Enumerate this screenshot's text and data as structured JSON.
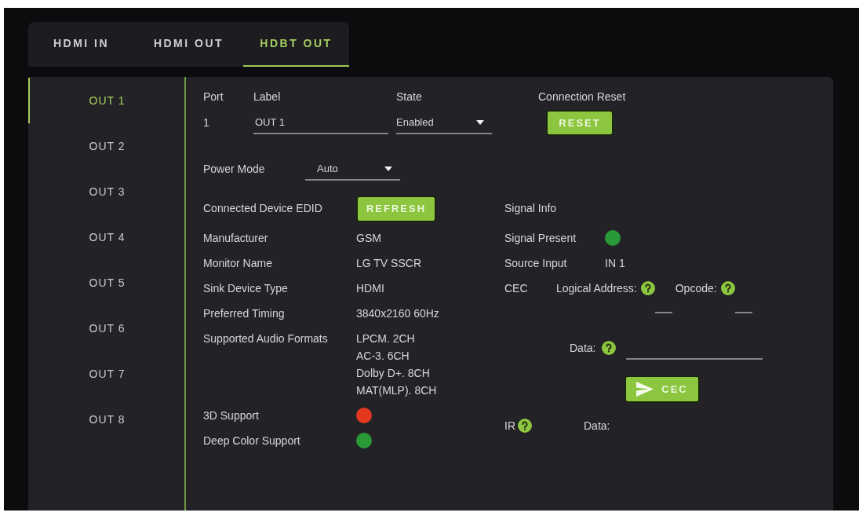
{
  "tabs": [
    {
      "label": "HDMI IN",
      "selected": false
    },
    {
      "label": "HDMI OUT",
      "selected": false
    },
    {
      "label": "HDBT OUT",
      "selected": true
    }
  ],
  "sidebar": {
    "items": [
      {
        "label": "OUT 1",
        "selected": true
      },
      {
        "label": "OUT 2",
        "selected": false
      },
      {
        "label": "OUT 3",
        "selected": false
      },
      {
        "label": "OUT 4",
        "selected": false
      },
      {
        "label": "OUT 5",
        "selected": false
      },
      {
        "label": "OUT 6",
        "selected": false
      },
      {
        "label": "OUT 7",
        "selected": false
      },
      {
        "label": "OUT 8",
        "selected": false
      }
    ]
  },
  "port_header": {
    "port": {
      "label": "Port",
      "value": "1"
    },
    "label": {
      "label": "Label",
      "value": "OUT 1"
    },
    "state": {
      "label": "State",
      "value": "Enabled"
    },
    "connection_reset": {
      "label": "Connection Reset",
      "button": "RESET"
    }
  },
  "power_mode": {
    "label": "Power Mode",
    "value": "Auto"
  },
  "edid": {
    "title": "Connected Device EDID",
    "button": "REFRESH",
    "rows": [
      {
        "kind": "text",
        "label": "Manufacturer",
        "values": [
          "GSM"
        ]
      },
      {
        "kind": "text",
        "label": "Monitor Name",
        "values": [
          "LG TV SSCR"
        ]
      },
      {
        "kind": "text",
        "label": "Sink Device Type",
        "values": [
          "HDMI"
        ]
      },
      {
        "kind": "text",
        "label": "Preferred Timing",
        "values": [
          "3840x2160 60Hz"
        ]
      },
      {
        "kind": "text",
        "label": "Supported Audio Formats",
        "values": [
          "LPCM. 2CH",
          "AC-3. 6CH",
          "Dolby D+. 8CH",
          "MAT(MLP). 8CH"
        ]
      },
      {
        "kind": "status",
        "label": "3D Support",
        "color": "#e5391f"
      },
      {
        "kind": "status",
        "label": "Deep Color Support",
        "color": "#2a9a38"
      }
    ]
  },
  "signal_info": {
    "title": "Signal Info",
    "rows": [
      {
        "kind": "status",
        "label": "Signal Present",
        "color": "#2a9a38"
      },
      {
        "kind": "text",
        "label": "Source Input",
        "values": [
          "IN 1"
        ]
      }
    ]
  },
  "cec": {
    "label": "CEC",
    "fields": [
      {
        "label": "Logical Address:"
      },
      {
        "label": "Opcode:"
      }
    ],
    "data_label": "Data:",
    "button": "CEC"
  },
  "ir": {
    "label": "IR",
    "data_label": "Data:"
  }
}
